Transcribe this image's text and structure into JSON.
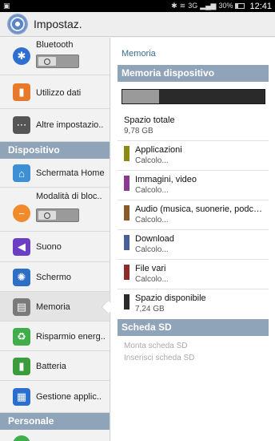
{
  "status_bar": {
    "battery": "30%",
    "time": "12:41",
    "network": "3G"
  },
  "action_bar": {
    "title": "Impostaz."
  },
  "left": {
    "items_top": [
      {
        "label": "Bluetooth",
        "icon": "bluetooth-icon"
      },
      {
        "label": "Utilizzo dati",
        "icon": "data-usage-icon"
      },
      {
        "label": "Altre impostazio..",
        "icon": "more-settings-icon"
      }
    ],
    "section_dispositivo": "Dispositivo",
    "items_device": [
      {
        "label": "Schermata Home",
        "icon": "home-icon"
      },
      {
        "label": "Modalità di bloc..",
        "icon": "blocking-mode-icon"
      },
      {
        "label": "Suono",
        "icon": "sound-icon"
      },
      {
        "label": "Schermo",
        "icon": "display-icon"
      },
      {
        "label": "Memoria",
        "icon": "storage-icon"
      },
      {
        "label": "Risparmio energ..",
        "icon": "power-saving-icon"
      },
      {
        "label": "Batteria",
        "icon": "battery-icon"
      },
      {
        "label": "Gestione applic..",
        "icon": "app-manager-icon"
      }
    ],
    "section_personale": "Personale"
  },
  "right": {
    "breadcrumb": "Memoria",
    "header_device": "Memoria dispositivo",
    "storage_used_fraction": 0.26,
    "total": {
      "label": "Spazio totale",
      "value": "9,78 GB"
    },
    "categories": [
      {
        "label": "Applicazioni",
        "value": "Calcolo...",
        "color": "#8a8a14"
      },
      {
        "label": "Immagini, video",
        "value": "Calcolo...",
        "color": "#8b3a91"
      },
      {
        "label": "Audio (musica, suonerie, podcast...",
        "value": "Calcolo...",
        "color": "#8a5a2a"
      },
      {
        "label": "Download",
        "value": "Calcolo...",
        "color": "#4a5f9a"
      },
      {
        "label": "File vari",
        "value": "Calcolo...",
        "color": "#8f2a2a"
      },
      {
        "label": "Spazio disponibile",
        "value": "7,24 GB",
        "color": "#2a2a2a"
      }
    ],
    "header_sd": "Scheda SD",
    "sd_mount": "Monta scheda SD",
    "sd_insert": "Inserisci scheda SD"
  }
}
